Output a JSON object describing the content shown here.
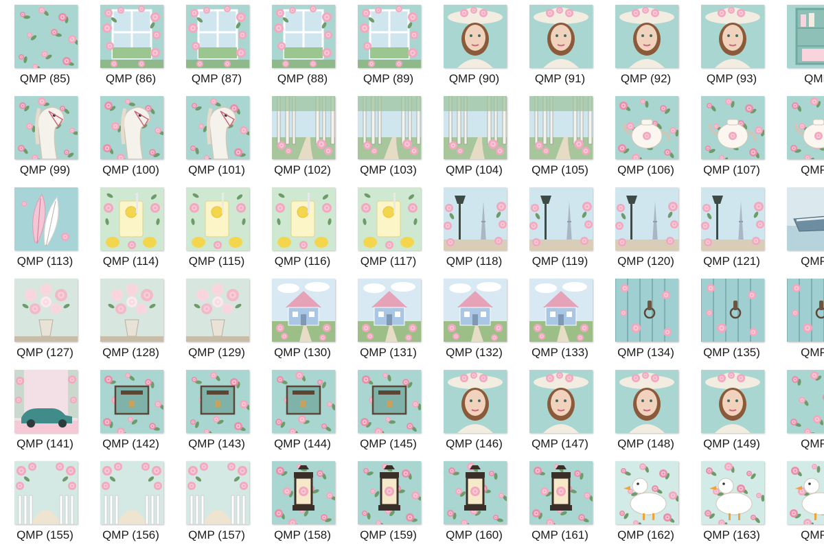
{
  "window": {
    "title": ""
  },
  "palette": {
    "teal": "#a9d6d0",
    "teal_dark": "#6fa9a2",
    "pink": "#f2a9bf",
    "pink_light": "#f9d3de",
    "green": "#6f9a6a",
    "cream": "#f3ece0",
    "brown": "#5b4636",
    "lemon": "#f4d64e",
    "sky": "#cfe6ef",
    "blue_house": "#a9c6e4",
    "skin": "#f1d2bd",
    "hair": "#8a5a3b"
  },
  "rows": [
    {
      "items": [
        {
          "label": "QMP (85)",
          "icon": "floral-pattern-icon"
        },
        {
          "label": "QMP (86)",
          "icon": "rose-window-icon"
        },
        {
          "label": "QMP (87)",
          "icon": "rose-window-icon"
        },
        {
          "label": "QMP (88)",
          "icon": "rose-window-icon"
        },
        {
          "label": "QMP (89)",
          "icon": "rose-window-icon"
        },
        {
          "label": "QMP (90)",
          "icon": "woman-portrait-icon"
        },
        {
          "label": "QMP (91)",
          "icon": "woman-portrait-icon"
        },
        {
          "label": "QMP (92)",
          "icon": "woman-portrait-icon"
        },
        {
          "label": "QMP (93)",
          "icon": "woman-portrait-icon"
        },
        {
          "label": "QMP",
          "icon": "cabinet-icon"
        }
      ]
    },
    {
      "items": [
        {
          "label": "QMP (99)",
          "icon": "white-horse-icon"
        },
        {
          "label": "QMP (100)",
          "icon": "white-horse-icon"
        },
        {
          "label": "QMP (101)",
          "icon": "white-horse-icon"
        },
        {
          "label": "QMP (102)",
          "icon": "birch-forest-icon"
        },
        {
          "label": "QMP (103)",
          "icon": "birch-forest-icon"
        },
        {
          "label": "QMP (104)",
          "icon": "birch-forest-icon"
        },
        {
          "label": "QMP (105)",
          "icon": "birch-forest-icon"
        },
        {
          "label": "QMP (106)",
          "icon": "teapot-icon"
        },
        {
          "label": "QMP (107)",
          "icon": "teapot-icon"
        },
        {
          "label": "QMP (",
          "icon": "teapot-icon"
        }
      ]
    },
    {
      "items": [
        {
          "label": "QMP (113)",
          "icon": "feathers-icon"
        },
        {
          "label": "QMP (114)",
          "icon": "lemonade-icon"
        },
        {
          "label": "QMP (115)",
          "icon": "lemonade-icon"
        },
        {
          "label": "QMP (116)",
          "icon": "lemonade-icon"
        },
        {
          "label": "QMP (117)",
          "icon": "lemonade-icon"
        },
        {
          "label": "QMP (118)",
          "icon": "paris-lamp-icon"
        },
        {
          "label": "QMP (119)",
          "icon": "paris-lamp-icon"
        },
        {
          "label": "QMP (120)",
          "icon": "paris-lamp-icon"
        },
        {
          "label": "QMP (121)",
          "icon": "paris-lamp-icon"
        },
        {
          "label": "QMP (",
          "icon": "boat-icon"
        }
      ]
    },
    {
      "items": [
        {
          "label": "QMP (127)",
          "icon": "flower-vase-icon"
        },
        {
          "label": "QMP (128)",
          "icon": "flower-vase-icon"
        },
        {
          "label": "QMP (129)",
          "icon": "flower-vase-icon"
        },
        {
          "label": "QMP (130)",
          "icon": "cottage-icon"
        },
        {
          "label": "QMP (131)",
          "icon": "cottage-icon"
        },
        {
          "label": "QMP (132)",
          "icon": "cottage-icon"
        },
        {
          "label": "QMP (133)",
          "icon": "cottage-icon"
        },
        {
          "label": "QMP (134)",
          "icon": "wood-door-icon"
        },
        {
          "label": "QMP (135)",
          "icon": "wood-door-icon"
        },
        {
          "label": "QMP (",
          "icon": "wood-door-icon"
        }
      ]
    },
    {
      "items": [
        {
          "label": "QMP (141)",
          "icon": "vintage-car-icon"
        },
        {
          "label": "QMP (142)",
          "icon": "mailbox-icon"
        },
        {
          "label": "QMP (143)",
          "icon": "mailbox-icon"
        },
        {
          "label": "QMP (144)",
          "icon": "mailbox-icon"
        },
        {
          "label": "QMP (145)",
          "icon": "mailbox-icon"
        },
        {
          "label": "QMP (146)",
          "icon": "woman-portrait-icon"
        },
        {
          "label": "QMP (147)",
          "icon": "woman-portrait-icon"
        },
        {
          "label": "QMP (148)",
          "icon": "woman-portrait-icon"
        },
        {
          "label": "QMP (149)",
          "icon": "woman-portrait-icon"
        },
        {
          "label": "QMP (",
          "icon": "floral-pattern-icon"
        }
      ]
    },
    {
      "items": [
        {
          "label": "QMP (155)",
          "icon": "garden-gate-icon"
        },
        {
          "label": "QMP (156)",
          "icon": "garden-gate-icon"
        },
        {
          "label": "QMP (157)",
          "icon": "garden-gate-icon"
        },
        {
          "label": "QMP (158)",
          "icon": "lantern-icon"
        },
        {
          "label": "QMP (159)",
          "icon": "lantern-icon"
        },
        {
          "label": "QMP (160)",
          "icon": "lantern-icon"
        },
        {
          "label": "QMP (161)",
          "icon": "lantern-icon"
        },
        {
          "label": "QMP (162)",
          "icon": "duck-icon"
        },
        {
          "label": "QMP (163)",
          "icon": "duck-icon"
        },
        {
          "label": "QMP (",
          "icon": "duck-icon"
        }
      ]
    }
  ]
}
